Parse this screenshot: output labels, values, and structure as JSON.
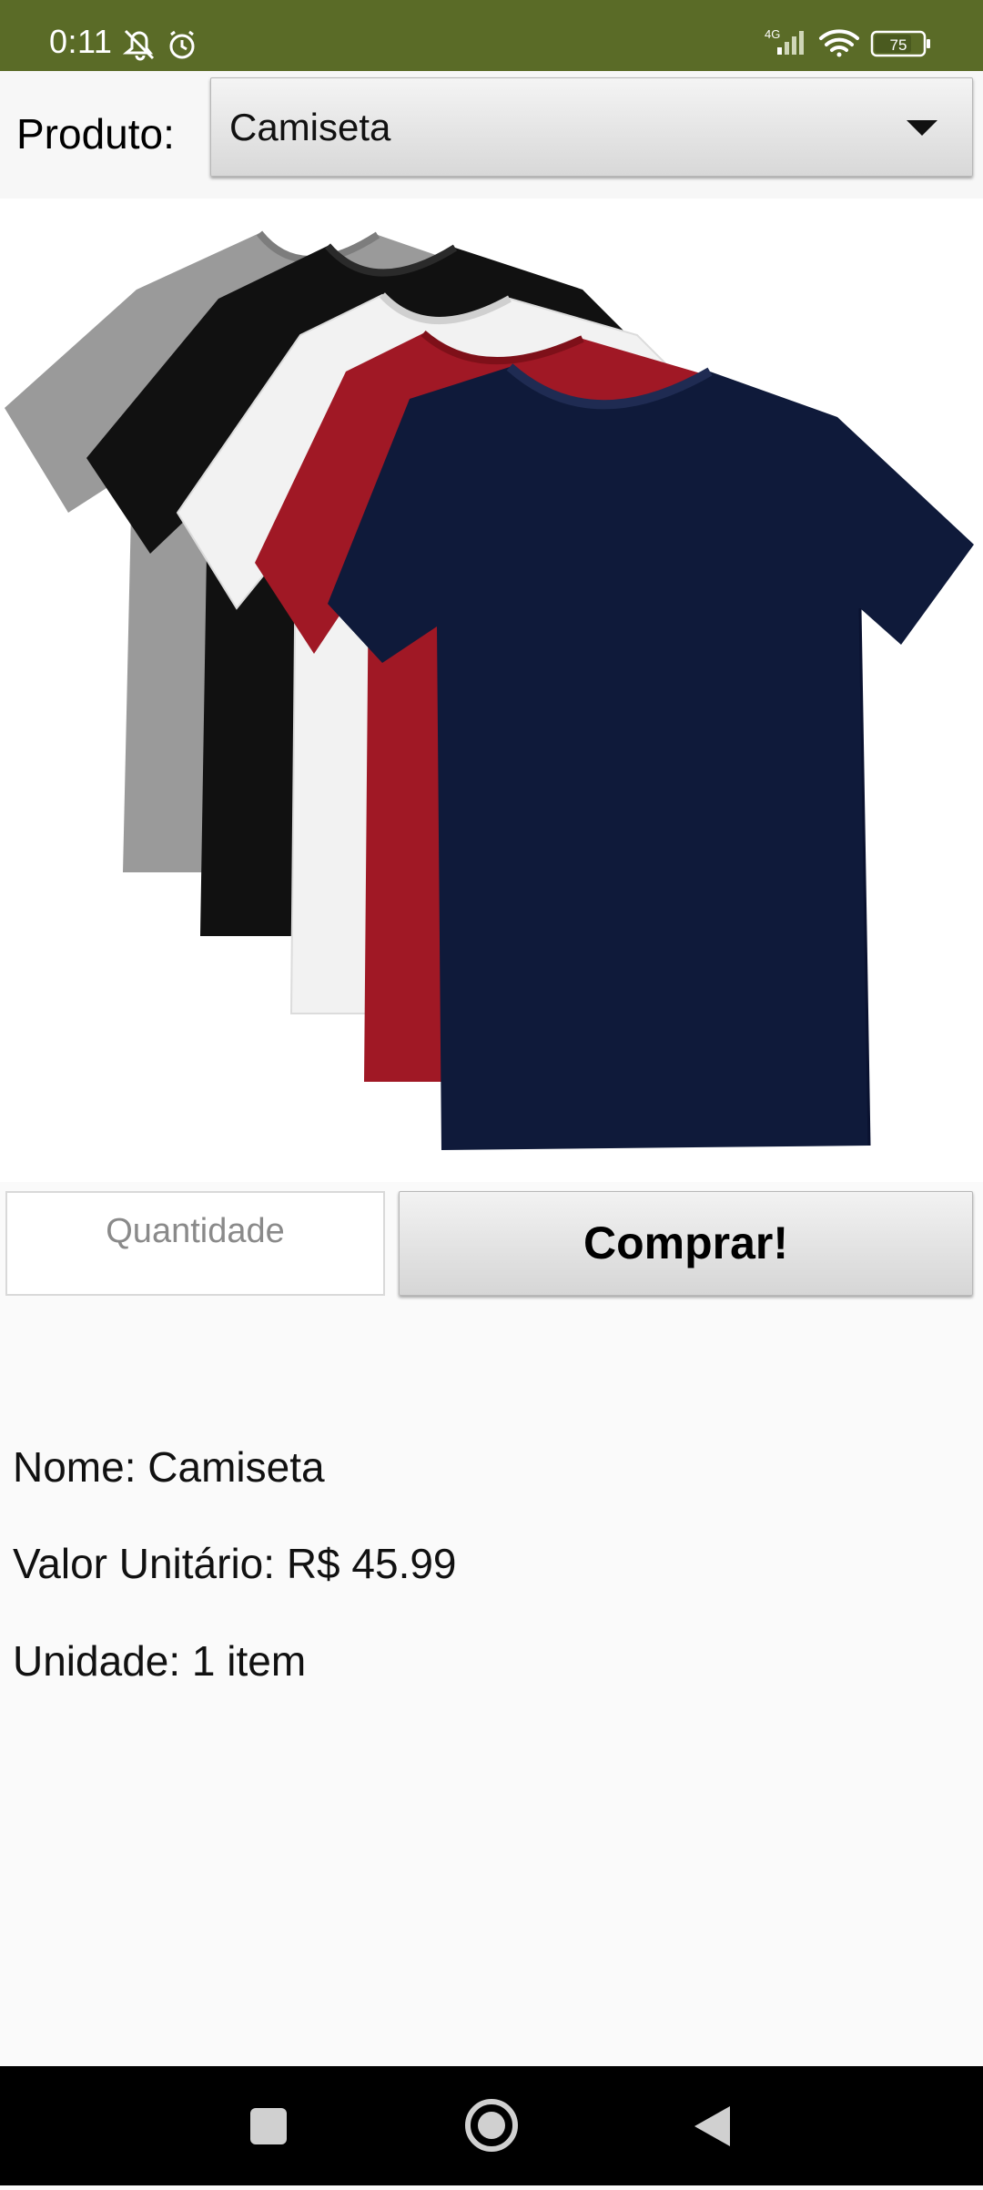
{
  "status_bar": {
    "time": "0:11",
    "network_label": "4G",
    "battery_level": "75",
    "icons": [
      "mute-icon",
      "alarm-icon",
      "signal-icon",
      "wifi-icon",
      "battery-icon"
    ]
  },
  "product_select": {
    "label": "Produto:",
    "selected": "Camiseta"
  },
  "product_image": {
    "description_icon": "tshirts-image",
    "shirt_colors": [
      "#9a9a9a",
      "#111111",
      "#f2f2f2",
      "#a01825",
      "#0f1a3a"
    ]
  },
  "order": {
    "quantity_placeholder": "Quantidade",
    "quantity_value": "",
    "buy_label": "Comprar!"
  },
  "details": {
    "name": "Nome: Camiseta",
    "unit_price": "Valor Unitário: R$ 45.99",
    "unit": "Unidade: 1 item"
  },
  "nav_bar": {
    "icons": [
      "recents-icon",
      "home-icon",
      "back-icon"
    ]
  },
  "colors": {
    "status_bar": "#5a6b27",
    "background": "#fafafa",
    "nav_bar": "#000000"
  }
}
